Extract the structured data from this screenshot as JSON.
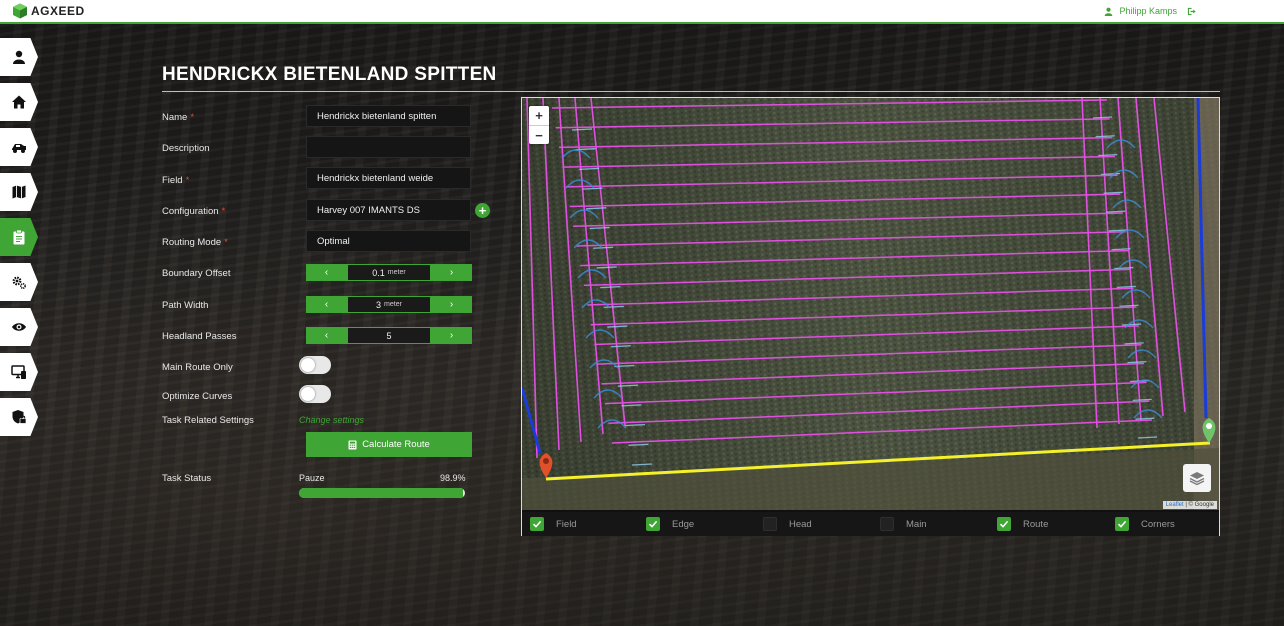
{
  "header": {
    "brand": "AGXEED",
    "user_name": "Philipp Kamps",
    "user_icon": "user-icon",
    "logout_icon": "logout-icon"
  },
  "sidebar": {
    "items": [
      {
        "name": "profile",
        "icon": "user-icon",
        "active": false
      },
      {
        "name": "home",
        "icon": "home-icon",
        "active": false
      },
      {
        "name": "machines",
        "icon": "tractor-icon",
        "active": false
      },
      {
        "name": "fields",
        "icon": "map-icon",
        "active": false
      },
      {
        "name": "tasks",
        "icon": "clipboard-icon",
        "active": true
      },
      {
        "name": "configurations",
        "icon": "gears-icon",
        "active": false
      },
      {
        "name": "monitor",
        "icon": "eye-icon",
        "active": false
      },
      {
        "name": "devices",
        "icon": "devices-icon",
        "active": false
      },
      {
        "name": "security",
        "icon": "shield-lock-icon",
        "active": false
      }
    ]
  },
  "page": {
    "title": "HENDRICKX BIETENLAND SPITTEN"
  },
  "form": {
    "name_label": "Name",
    "name_value": "Hendrickx bietenland spitten",
    "description_label": "Description",
    "description_value": "",
    "field_label": "Field",
    "field_value": "Hendrickx bietenland weide",
    "configuration_label": "Configuration",
    "configuration_value": "Harvey 007 IMANTS DS",
    "add_configuration_label": "+",
    "routing_mode_label": "Routing Mode",
    "routing_mode_value": "Optimal",
    "required_marker": "*",
    "boundary_offset_label": "Boundary Offset",
    "boundary_offset_value": "0.1",
    "boundary_offset_unit": "meter",
    "path_width_label": "Path Width",
    "path_width_value": "3",
    "path_width_unit": "meter",
    "headland_passes_label": "Headland Passes",
    "headland_passes_value": "5",
    "stepper_prev": "‹",
    "stepper_next": "›",
    "main_route_only_label": "Main Route Only",
    "main_route_only_on": false,
    "optimize_curves_label": "Optimize Curves",
    "optimize_curves_on": false,
    "task_related_label": "Task Related Settings",
    "change_settings_link": "Change settings",
    "calculate_button": "Calculate Route",
    "task_status_label": "Task Status",
    "task_status_value": "Pauze",
    "task_progress_text": "98.9%",
    "task_progress": 0.989
  },
  "map": {
    "zoom_in": "+",
    "zoom_out": "−",
    "attribution_leaflet": "Leaflet",
    "attribution_sep": " | © ",
    "attribution_google": "Google",
    "colors": {
      "route": "#e050e0",
      "edge": "#1a3cd8",
      "corners": "#3a8fd8",
      "baseline": "#f4f02a",
      "start_marker": "#e0502a",
      "end_marker": "#6fc46a"
    },
    "layers": [
      {
        "label": "Field",
        "checked": true
      },
      {
        "label": "Edge",
        "checked": true
      },
      {
        "label": "Head",
        "checked": false
      },
      {
        "label": "Main",
        "checked": false
      },
      {
        "label": "Route",
        "checked": true
      },
      {
        "label": "Corners",
        "checked": true
      }
    ]
  }
}
